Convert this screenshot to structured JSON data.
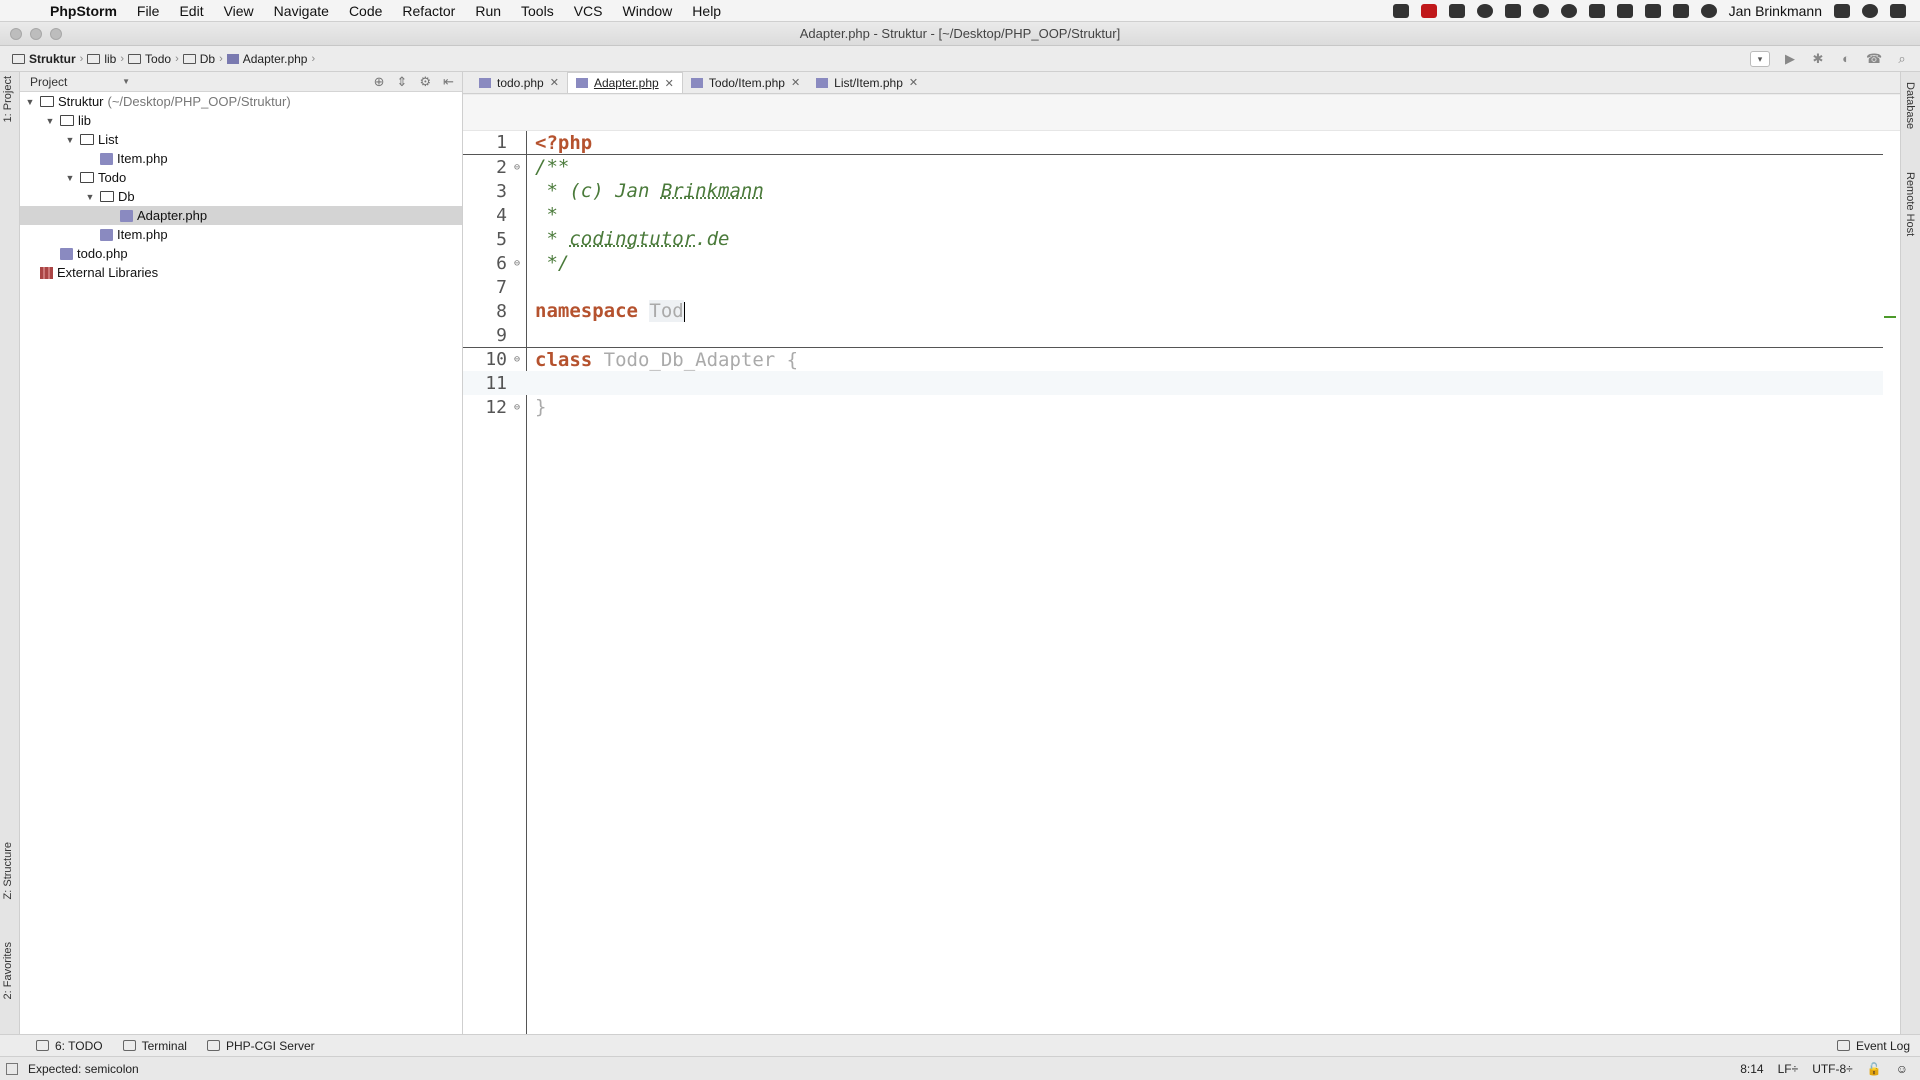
{
  "menubar": {
    "app": "PhpStorm",
    "items": [
      "File",
      "Edit",
      "View",
      "Navigate",
      "Code",
      "Refactor",
      "Run",
      "Tools",
      "VCS",
      "Window",
      "Help"
    ],
    "user": "Jan Brinkmann"
  },
  "window": {
    "title": "Adapter.php - Struktur - [~/Desktop/PHP_OOP/Struktur]"
  },
  "breadcrumbs": [
    "Struktur",
    "lib",
    "Todo",
    "Db",
    "Adapter.php"
  ],
  "left_strip": {
    "project_tab": "1: Project",
    "structure_tab": "Z: Structure",
    "favorites_tab": "2: Favorites"
  },
  "right_strip": {
    "database_tab": "Database",
    "remote_host_tab": "Remote Host"
  },
  "project_panel": {
    "view_mode": "Project",
    "tree": [
      {
        "label": "Struktur",
        "hint": "(~/Desktop/PHP_OOP/Struktur)",
        "type": "folder",
        "level": 0,
        "expanded": true
      },
      {
        "label": "lib",
        "type": "folder",
        "level": 1,
        "expanded": true
      },
      {
        "label": "List",
        "type": "folder",
        "level": 2,
        "expanded": true
      },
      {
        "label": "Item.php",
        "type": "php",
        "level": 3
      },
      {
        "label": "Todo",
        "type": "folder",
        "level": 2,
        "expanded": true
      },
      {
        "label": "Db",
        "type": "folder",
        "level": 3,
        "expanded": true
      },
      {
        "label": "Adapter.php",
        "type": "php",
        "level": 4,
        "selected": true
      },
      {
        "label": "Item.php",
        "type": "php",
        "level": 3
      },
      {
        "label": "todo.php",
        "type": "php",
        "level": 1
      },
      {
        "label": "External Libraries",
        "type": "lib",
        "level": 0
      }
    ]
  },
  "editor_tabs": [
    {
      "label": "todo.php",
      "active": false
    },
    {
      "label": "Adapter.php",
      "active": true
    },
    {
      "label": "Todo/Item.php",
      "active": false
    },
    {
      "label": "List/Item.php",
      "active": false
    }
  ],
  "code_lines": [
    {
      "n": "1",
      "tokens": [
        {
          "t": "<?php",
          "c": "tok-kw"
        }
      ]
    },
    {
      "n": "2",
      "fold": "⊖",
      "tokens": [
        {
          "t": "/**",
          "c": "tok-com"
        }
      ]
    },
    {
      "n": "3",
      "tokens": [
        {
          "t": " * (c) Jan ",
          "c": "tok-com"
        },
        {
          "t": "Brinkmann",
          "c": "tok-com-u"
        }
      ]
    },
    {
      "n": "4",
      "tokens": [
        {
          "t": " *",
          "c": "tok-com"
        }
      ]
    },
    {
      "n": "5",
      "tokens": [
        {
          "t": " * ",
          "c": "tok-com"
        },
        {
          "t": "codingtutor",
          "c": "tok-com-u"
        },
        {
          "t": ".de",
          "c": "tok-com"
        }
      ]
    },
    {
      "n": "6",
      "fold": "⊖",
      "tokens": [
        {
          "t": " */",
          "c": "tok-com"
        }
      ]
    },
    {
      "n": "7",
      "tokens": []
    },
    {
      "n": "8",
      "tokens": [
        {
          "t": "namespace ",
          "c": "tok-kw"
        },
        {
          "t": "Tod",
          "c": "tok-dim-bg"
        }
      ]
    },
    {
      "n": "9",
      "tokens": []
    },
    {
      "n": "10",
      "fold": "⊖",
      "tokens": [
        {
          "t": "class ",
          "c": "tok-kw"
        },
        {
          "t": "Todo_Db_Adapter {",
          "c": "tok-dim"
        }
      ]
    },
    {
      "n": "11",
      "tokens": []
    },
    {
      "n": "12",
      "fold": "⊖",
      "tokens": [
        {
          "t": "}",
          "c": "tok-dim"
        }
      ]
    }
  ],
  "bottom_tools": {
    "todo": "6: TODO",
    "terminal": "Terminal",
    "server": "PHP-CGI Server",
    "event_log": "Event Log"
  },
  "status": {
    "message": "Expected: semicolon",
    "position": "8:14",
    "line_sep": "LF÷",
    "encoding": "UTF-8÷"
  }
}
